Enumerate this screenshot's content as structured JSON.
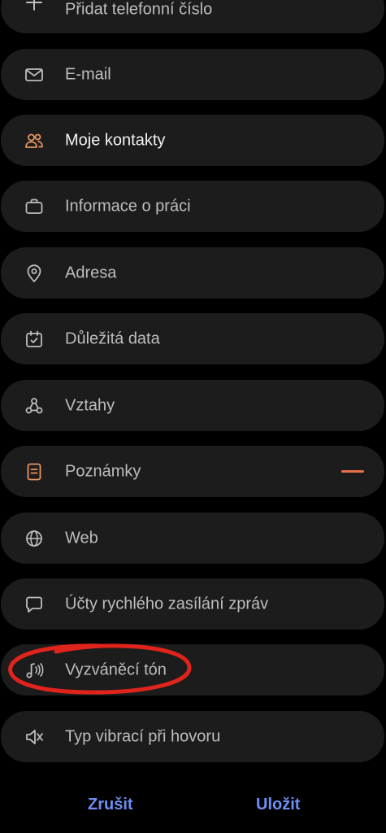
{
  "colors": {
    "row_background": "#1c1c1c",
    "label": "#bdbdbd",
    "label_active": "#f4f4f4",
    "accent_orange": "#e8724a",
    "button_blue": "#6e8df5",
    "annotation_red": "#e0241b"
  },
  "fields": [
    {
      "label": "Přidat telefonní číslo",
      "icon": "plus-icon"
    },
    {
      "label": "E-mail",
      "icon": "mail-icon"
    },
    {
      "label": "Moje kontakty",
      "icon": "people-icon"
    },
    {
      "label": "Informace o práci",
      "icon": "briefcase-icon"
    },
    {
      "label": "Adresa",
      "icon": "location-pin-icon"
    },
    {
      "label": "Důležitá data",
      "icon": "calendar-icon"
    },
    {
      "label": "Vztahy",
      "icon": "relationships-icon"
    },
    {
      "label": "Poznámky",
      "icon": "note-icon",
      "remove_icon": "minus-icon"
    },
    {
      "label": "Web",
      "icon": "globe-icon"
    },
    {
      "label": "Účty rychlého zasílání zpráv",
      "icon": "chat-bubble-icon"
    },
    {
      "label": "Vyzváněcí tón",
      "icon": "ringtone-icon"
    },
    {
      "label": "Typ vibrací při hovoru",
      "icon": "vibration-icon"
    }
  ],
  "actions": {
    "cancel_label": "Zrušit",
    "save_label": "Uložit"
  }
}
